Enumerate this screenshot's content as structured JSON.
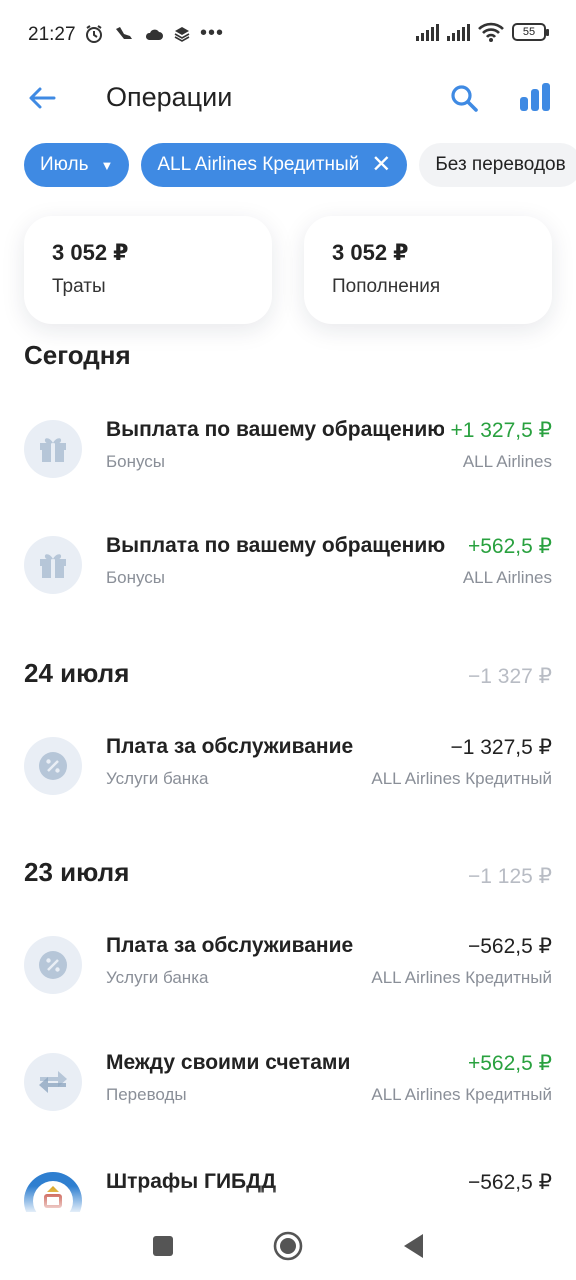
{
  "status_bar": {
    "time": "21:27",
    "battery": "55"
  },
  "header": {
    "title": "Операции"
  },
  "filters": {
    "month": "Июль",
    "account": "ALL Airlines Кредитный",
    "no_transfers": "Без переводов"
  },
  "summary": {
    "spent_amount": "3 052 ₽",
    "spent_label": "Траты",
    "topup_amount": "3 052 ₽",
    "topup_label": "Пополнения"
  },
  "sections": [
    {
      "title": "Сегодня",
      "total": "",
      "items": [
        {
          "title": "Выплата по вашему обращению",
          "category": "Бонусы",
          "amount": "+1 327,5 ₽",
          "account": "ALL Airlines",
          "icon": "gift-icon"
        },
        {
          "title": "Выплата по вашему обращению",
          "category": "Бонусы",
          "amount": "+562,5 ₽",
          "account": "ALL Airlines",
          "icon": "gift-icon"
        }
      ]
    },
    {
      "title": "24 июля",
      "total": "−1 327 ₽",
      "items": [
        {
          "title": "Плата за обслуживание",
          "category": "Услуги банка",
          "amount": "−1 327,5 ₽",
          "account": "ALL Airlines Кредитный",
          "icon": "percent-icon"
        }
      ]
    },
    {
      "title": "23 июля",
      "total": "−1 125 ₽",
      "items": [
        {
          "title": "Плата за обслуживание",
          "category": "Услуги банка",
          "amount": "−562,5 ₽",
          "account": "ALL Airlines Кредитный",
          "icon": "percent-icon"
        },
        {
          "title": "Между своими счетами",
          "category": "Переводы",
          "amount": "+562,5 ₽",
          "account": "ALL Airlines Кредитный",
          "icon": "transfer-arrows-icon"
        },
        {
          "title": "Штрафы ГИБДД",
          "category": "",
          "amount": "−562,5 ₽",
          "account": "",
          "icon": "traffic-police-emblem-icon"
        }
      ]
    }
  ],
  "colors": {
    "accent": "#3f8ae3",
    "positive": "#29a13f",
    "muted": "#8a8f98"
  }
}
